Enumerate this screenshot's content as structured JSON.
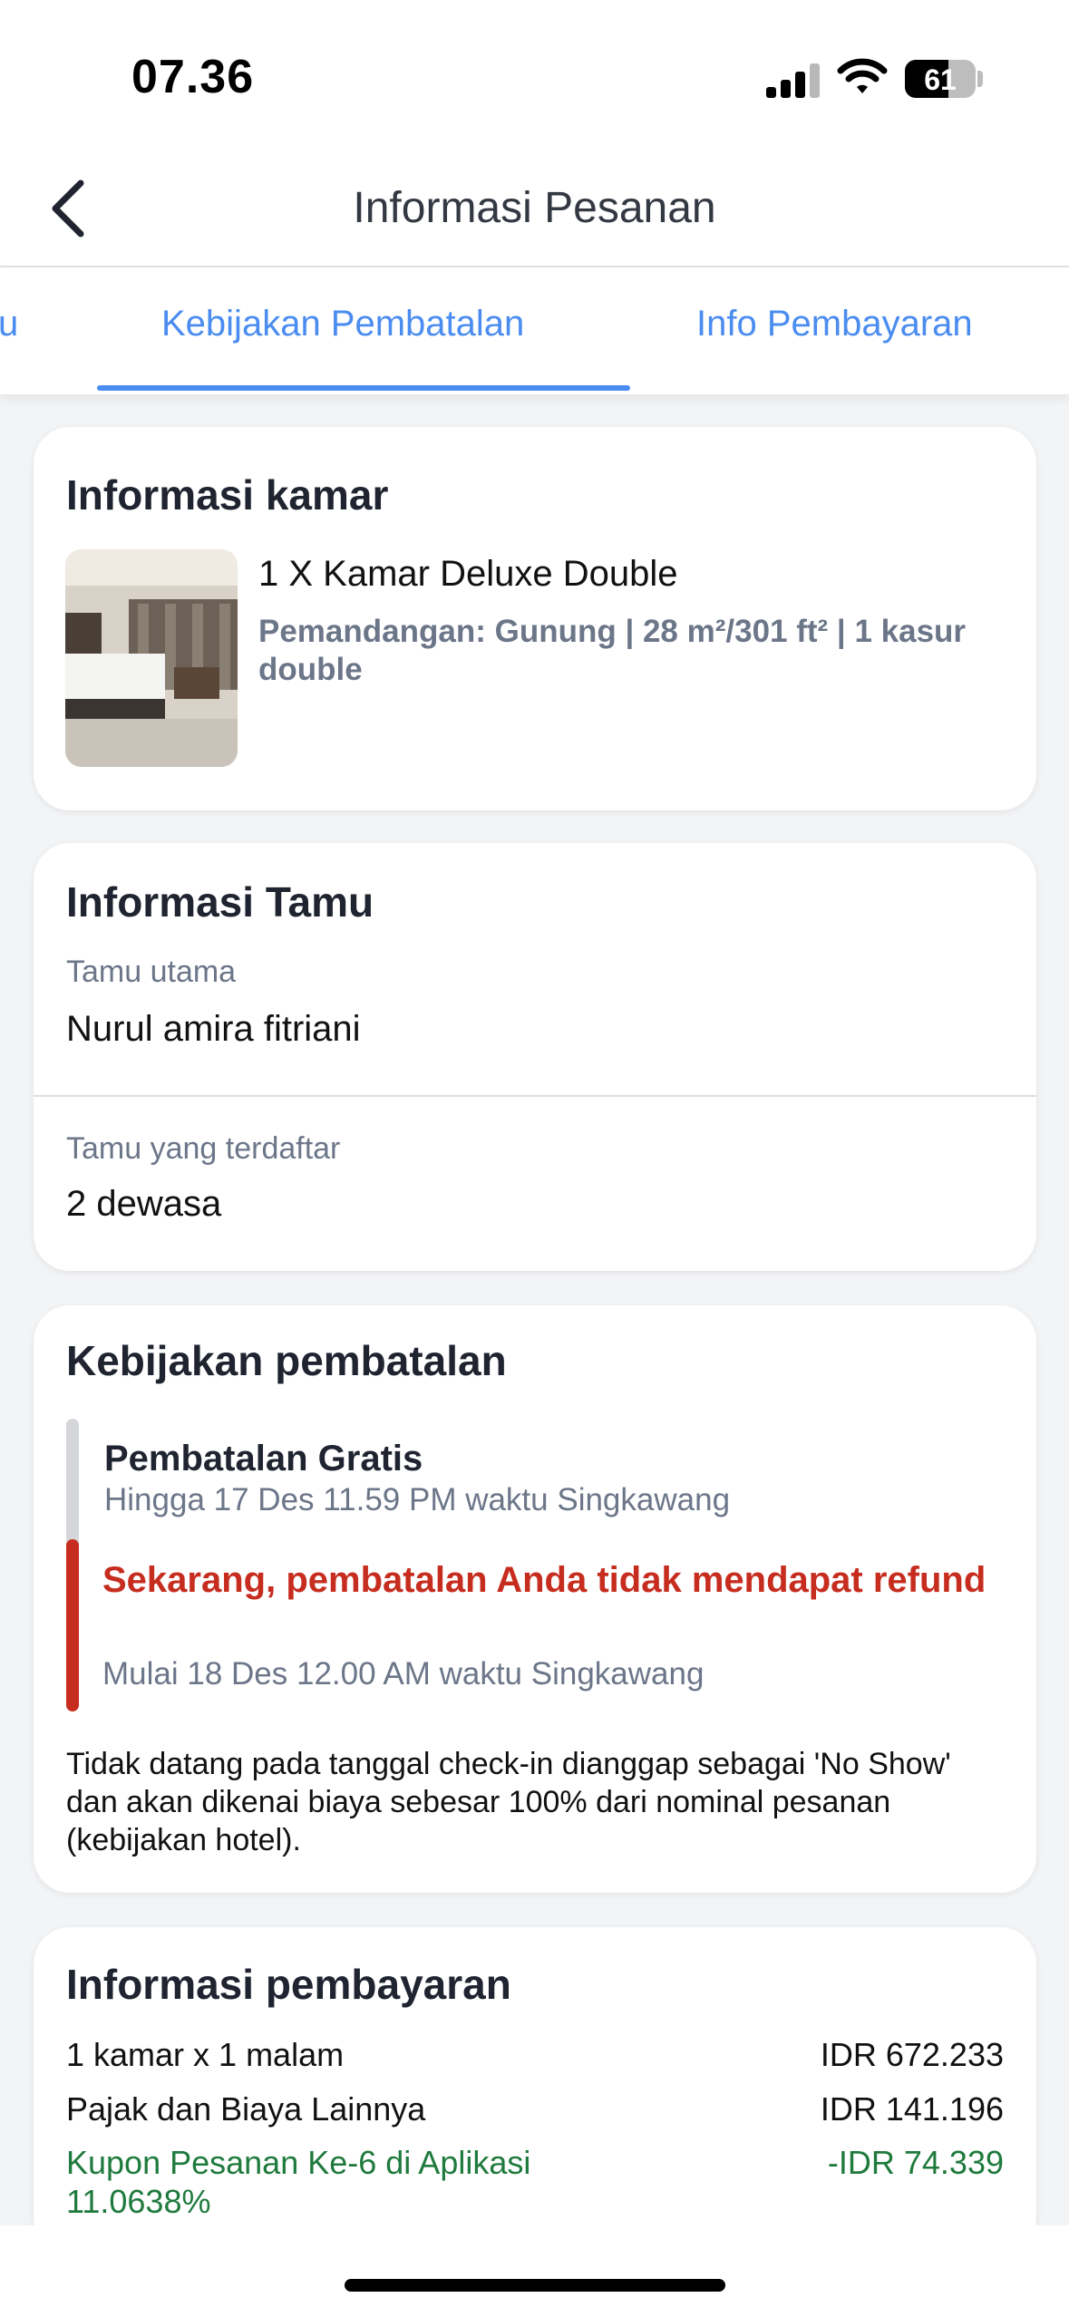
{
  "status_bar": {
    "time": "07.36",
    "battery_level": "61",
    "battery_fraction": 0.61
  },
  "header": {
    "title": "Informasi Pesanan",
    "back_icon": "chevron-left-icon"
  },
  "tabs": {
    "items": [
      {
        "label": "Informasi Tamu",
        "visible_fragment": "u",
        "active": false
      },
      {
        "label": "Kebijakan Pembatalan",
        "active": true
      },
      {
        "label": "Info Pembayaran",
        "active": false
      }
    ],
    "accent_color": "#4a8cf0"
  },
  "room_card": {
    "title": "Informasi kamar",
    "room_name": "1 X Kamar Deluxe Double",
    "room_desc": "Pemandangan: Gunung | 28 m²/301 ft² | 1 kasur double",
    "image_icon": "hotel-room-photo"
  },
  "guest_card": {
    "title": "Informasi Tamu",
    "main_guest_label": "Tamu utama",
    "main_guest_value": "Nurul amira fitriani",
    "registered_label": "Tamu yang terdaftar",
    "registered_value": "2 dewasa"
  },
  "cancel_card": {
    "title": "Kebijakan pembatalan",
    "free_title": "Pembatalan Gratis",
    "free_sub": "Hingga 17 Des 11.59 PM waktu Singkawang",
    "norefund_title": "Sekarang, pembatalan Anda tidak mendapat refund",
    "norefund_sub": "Mulai 18 Des 12.00 AM waktu Singkawang",
    "noshow_text": "Tidak datang pada tanggal check-in dianggap sebagai 'No Show' dan akan dikenai biaya sebesar 100% dari nominal pesanan (kebijakan hotel).",
    "red_color": "#c62d1f"
  },
  "payment_card": {
    "title": "Informasi pembayaran",
    "rows": [
      {
        "label": "1 kamar x 1 malam",
        "value": "IDR 672.233"
      },
      {
        "label": "Pajak dan Biaya Lainnya",
        "value": "IDR 141.196"
      },
      {
        "label": "Kupon Pesanan Ke-6 di Aplikasi 11.0638%",
        "value": "-IDR 74.339"
      }
    ],
    "discount_color": "#1f7a3d"
  }
}
